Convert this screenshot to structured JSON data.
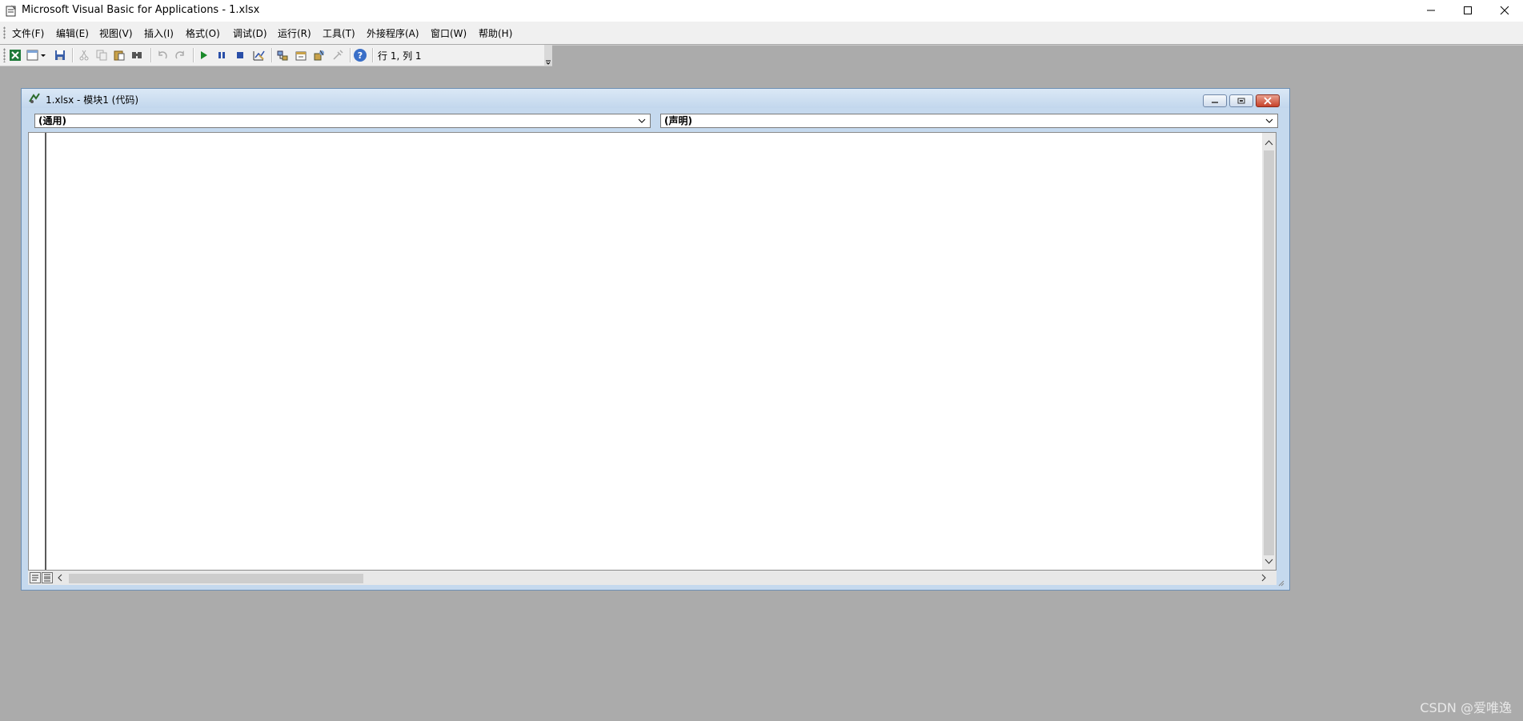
{
  "window": {
    "title": "Microsoft Visual Basic for Applications - 1.xlsx",
    "controls": {
      "minimize": "—",
      "maximize": "☐",
      "close": "✕"
    }
  },
  "menu": {
    "items": [
      "文件(F)",
      "编辑(E)",
      "视图(V)",
      "插入(I)",
      "格式(O)",
      "调试(D)",
      "运行(R)",
      "工具(T)",
      "外接程序(A)",
      "窗口(W)",
      "帮助(H)"
    ]
  },
  "toolbar": {
    "position_text": "行 1, 列 1",
    "icons": [
      "excel-icon",
      "insert-userform-icon",
      "save-icon",
      "cut-icon",
      "copy-icon",
      "paste-icon",
      "find-icon",
      "undo-icon",
      "redo-icon",
      "run-icon",
      "break-icon",
      "reset-icon",
      "design-mode-icon",
      "project-explorer-icon",
      "properties-icon",
      "object-browser-icon",
      "toolbox-icon",
      "help-icon"
    ]
  },
  "code_window": {
    "title": "1.xlsx - 模块1 (代码)",
    "object_combo": "(通用)",
    "procedure_combo": "(声明)"
  },
  "watermark": "CSDN @爱唯逸",
  "colors": {
    "background": "#ababab",
    "titlebar": "#ffffff",
    "code_caption": "#c5d9ee"
  }
}
